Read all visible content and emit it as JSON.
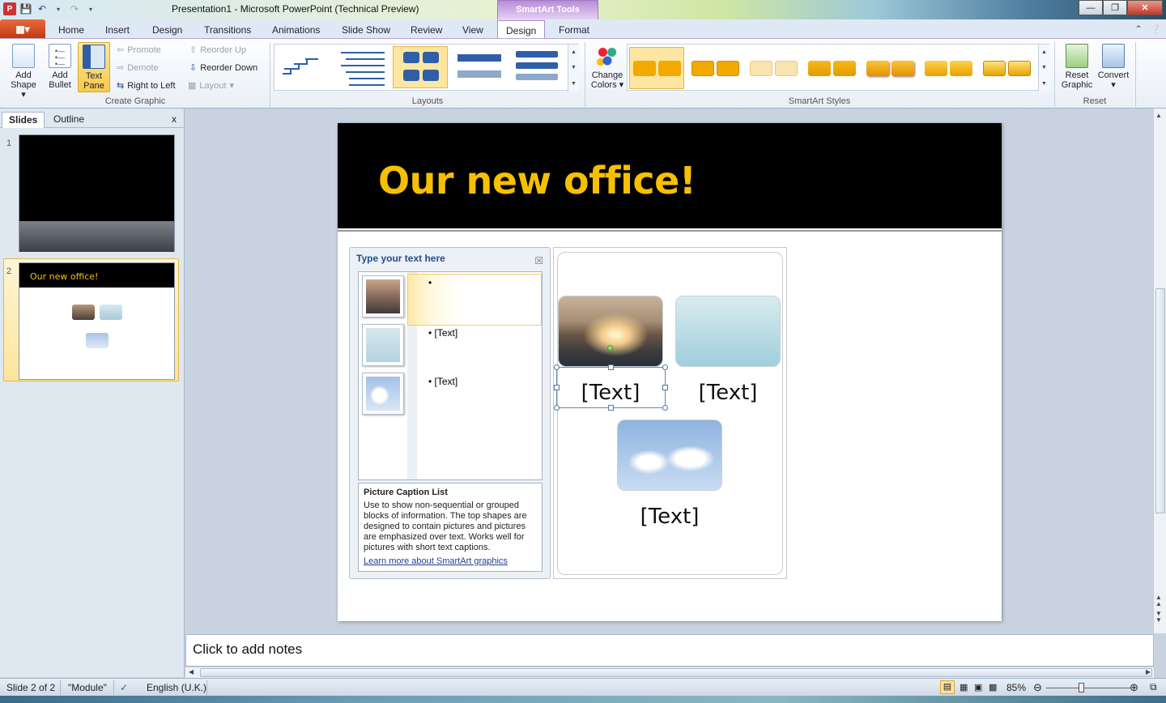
{
  "window": {
    "title": "Presentation1  -  Microsoft PowerPoint (Technical Preview)",
    "context_tools": "SmartArt Tools",
    "app_logo": "P"
  },
  "file_tab": {
    "label": "File"
  },
  "tabs": [
    "Home",
    "Insert",
    "Design",
    "Transitions",
    "Animations",
    "Slide Show",
    "Review",
    "View",
    "Design",
    "Format"
  ],
  "active_tab": "Design",
  "ribbon": {
    "create_graphic": {
      "label": "Create Graphic",
      "add_shape": "Add Shape",
      "add_shape_line1": "Add",
      "add_shape_line2": "Shape",
      "add_bullet_line1": "Add",
      "add_bullet_line2": "Bullet",
      "text_pane_line1": "Text",
      "text_pane_line2": "Pane",
      "promote": "Promote",
      "demote": "Demote",
      "right_to_left": "Right to Left",
      "reorder_up": "Reorder Up",
      "reorder_down": "Reorder Down",
      "layout": "Layout"
    },
    "layouts": {
      "label": "Layouts"
    },
    "smartart_styles": {
      "label": "SmartArt Styles",
      "change_colors_line1": "Change",
      "change_colors_line2": "Colors"
    },
    "reset": {
      "label": "Reset",
      "reset_graphic_line1": "Reset",
      "reset_graphic_line2": "Graphic",
      "convert": "Convert"
    }
  },
  "left_panel": {
    "tab_slides": "Slides",
    "tab_outline": "Outline",
    "close": "x",
    "slide1_num": "1",
    "slide2_num": "2",
    "slide2_title": "Our new office!"
  },
  "slide": {
    "title": "Our new office!"
  },
  "text_pane": {
    "heading": "Type your text here",
    "bullets": [
      "",
      "[Text]",
      "[Text]"
    ],
    "desc_title": "Picture Caption List",
    "desc_body": "Use to show non-sequential or grouped blocks of information. The top shapes are designed to contain pictures and pictures are emphasized over text. Works well for pictures with short text captions.",
    "desc_link": "Learn more about SmartArt graphics"
  },
  "smartart": {
    "captions": [
      "[Text]",
      "[Text]",
      "[Text]"
    ]
  },
  "notes": {
    "placeholder": "Click to add notes"
  },
  "status": {
    "slide": "Slide 2 of 2",
    "theme": "\"Module\"",
    "language": "English (U.K.)",
    "zoom": "85%"
  },
  "colors": {
    "accent_title": "#f6c000",
    "style_orange": "#f2a900",
    "ribbon_context": "#b98bd8"
  }
}
